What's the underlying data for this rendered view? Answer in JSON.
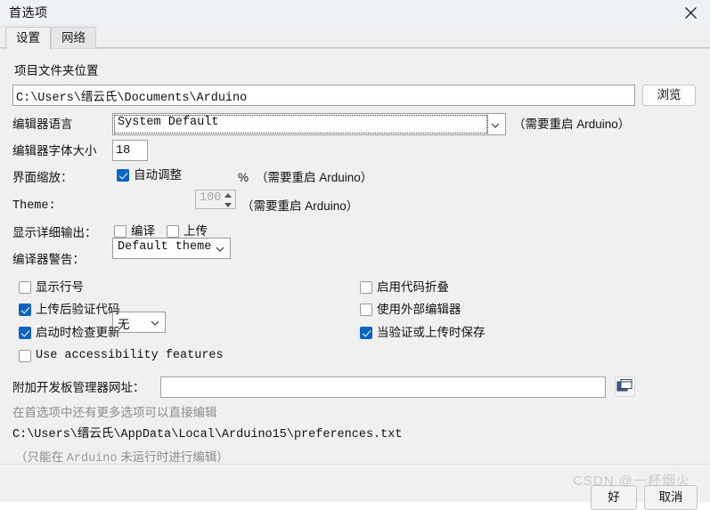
{
  "window": {
    "title": "首选项",
    "close_icon": "close-icon"
  },
  "tabs": [
    {
      "label": "设置",
      "active": true
    },
    {
      "label": "网络",
      "active": false
    }
  ],
  "settings": {
    "sketchbook": {
      "label": "项目文件夹位置",
      "value": "C:\\Users\\缙云氏\\Documents\\Arduino",
      "browse_label": "浏览"
    },
    "editor_language": {
      "label": "编辑器语言",
      "value": "System Default",
      "note": "（需要重启 Arduino）"
    },
    "editor_font_size": {
      "label": "编辑器字体大小",
      "value": "18"
    },
    "interface_scale": {
      "label": "界面缩放：",
      "auto_label": "自动调整",
      "auto_checked": true,
      "scale_value": "100",
      "percent": "%",
      "note": "（需要重启 Arduino）"
    },
    "theme": {
      "label": "Theme:",
      "value": "Default theme",
      "note": "（需要重启 Arduino）"
    },
    "verbose": {
      "label": "显示详细输出：",
      "compile_label": "编译",
      "compile_checked": false,
      "upload_label": "上传",
      "upload_checked": false
    },
    "compiler_warnings": {
      "label": "编译器警告：",
      "value": "无"
    },
    "checkboxes_left": [
      {
        "label": "显示行号",
        "checked": false,
        "mono": false
      },
      {
        "label": "上传后验证代码",
        "checked": true,
        "mono": false
      },
      {
        "label": "启动时检查更新",
        "checked": true,
        "mono": false
      },
      {
        "label": "Use accessibility features",
        "checked": false,
        "mono": true
      }
    ],
    "checkboxes_right": [
      {
        "label": "启用代码折叠",
        "checked": false,
        "mono": false
      },
      {
        "label": "使用外部编辑器",
        "checked": false,
        "mono": false
      },
      {
        "label": "当验证或上传时保存",
        "checked": true,
        "mono": false
      }
    ],
    "board_urls": {
      "label": "附加开发板管理器网址：",
      "value": "",
      "icon": "open-windows-icon"
    },
    "more_prefs_hint": "在首选项中还有更多选项可以直接编辑",
    "prefs_path": "C:\\Users\\缙云氏\\AppData\\Local\\Arduino15\\preferences.txt",
    "edit_note_prefix": "（只能在 ",
    "edit_note_mono": "Arduino",
    "edit_note_suffix": " 未运行时进行编辑）"
  },
  "footer": {
    "ok_label": "好",
    "cancel_label": "取消"
  },
  "watermark": "CSDN @一杯烟火",
  "colors": {
    "accent": "#0a65c2",
    "window_bg": "#f0f0f0",
    "titlebar_bg": "#eef2f6",
    "hint_text": "#8c8c8c"
  }
}
